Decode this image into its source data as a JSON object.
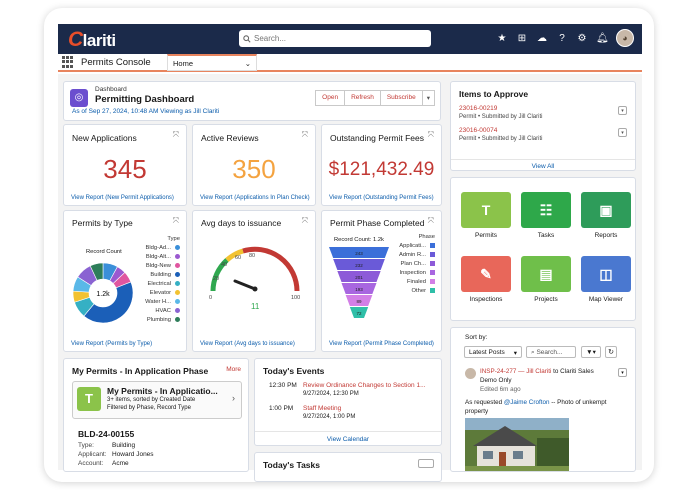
{
  "app": {
    "logo": "lariti",
    "logo_c": "C",
    "search_placeholder": "Search...",
    "app_name": "Permits Console",
    "tab": "Home"
  },
  "header": {
    "small": "Dashboard",
    "title": "Permitting Dashboard",
    "asof": "As of Sep 27, 2024, 10:48 AM Viewing as Jill Clariti",
    "buttons": [
      "Open",
      "Refresh",
      "Subscribe"
    ]
  },
  "kpis": [
    {
      "title": "New Applications",
      "value": "345",
      "color": "#c23934",
      "link": "View Report (New Permit Applications)"
    },
    {
      "title": "Active Reviews",
      "value": "350",
      "color": "#f4a340",
      "link": "View Report (Applications In Plan Check)"
    },
    {
      "title": "Outstanding Permit Fees",
      "value": "$121,432.49",
      "color": "#c23934",
      "link": "View Report (Outstanding Permit Fees)"
    }
  ],
  "permits_by_type": {
    "title": "Permits by Type",
    "legend_title": "Type",
    "record_count_label": "Record Count",
    "center": "1.2k",
    "link": "View Report (Permits by Type)",
    "items": [
      {
        "label": "Bldg-Ad...",
        "color": "#3b8fd9"
      },
      {
        "label": "Bldg-Alt...",
        "color": "#9b59d0"
      },
      {
        "label": "Bldg-New",
        "color": "#e056a0"
      },
      {
        "label": "Building",
        "color": "#1b5fb8"
      },
      {
        "label": "Electrical",
        "color": "#35b0c4"
      },
      {
        "label": "Elevator",
        "color": "#f2c231"
      },
      {
        "label": "Water H...",
        "color": "#5ab8e8"
      },
      {
        "label": "HVAC",
        "color": "#8a63d2"
      },
      {
        "label": "Plumbing",
        "color": "#2e7d5a"
      }
    ]
  },
  "avg_days": {
    "title": "Avg days to issuance",
    "value": "11",
    "min": "0",
    "max": "100",
    "ticks": [
      "20",
      "40",
      "60",
      "80"
    ],
    "link": "View Report (Avg days to issuance)"
  },
  "phase": {
    "title": "Permit Phase Completed",
    "record_count": "Record Count: 1.2k",
    "legend_title": "Phase",
    "link": "View Report (Permit Phase Completed)",
    "legend": [
      {
        "label": "Applicati...",
        "color": "#3b6fd9"
      },
      {
        "label": "Admin R...",
        "color": "#6a5ad8"
      },
      {
        "label": "Plan Ch...",
        "color": "#8d5ad8"
      },
      {
        "label": "Inspection",
        "color": "#a866e0"
      },
      {
        "label": "Finaled",
        "color": "#d27fe6"
      },
      {
        "label": "Other",
        "color": "#2fbfa8"
      }
    ],
    "bar_labels": [
      "243",
      "232",
      "201",
      "193",
      "89",
      "72"
    ]
  },
  "approve": {
    "title": "Items to Approve",
    "view_all": "View All",
    "items": [
      {
        "id": "23016-00219",
        "sub": "Permit  •  Submitted by Jill Clariti"
      },
      {
        "id": "23016-00074",
        "sub": "Permit  •  Submitted by Jill Clariti"
      }
    ]
  },
  "tiles": [
    {
      "label": "Permits",
      "color": "#8bc34a",
      "glyph": "T"
    },
    {
      "label": "Tasks",
      "color": "#2ea84a",
      "glyph": "☷"
    },
    {
      "label": "Reports",
      "color": "#2e9c5a",
      "glyph": "▣"
    },
    {
      "label": "Inspections",
      "color": "#e8675a",
      "glyph": "✎"
    },
    {
      "label": "Projects",
      "color": "#6fbf4a",
      "glyph": "▤"
    },
    {
      "label": "Map Viewer",
      "color": "#4a78d0",
      "glyph": "◫"
    }
  ],
  "my_permits": {
    "title": "My Permits - In Application Phase",
    "more": "More",
    "list_title": "My Permits - In Applicatio...",
    "sub1": "3+ items, sorted by Created Date",
    "sub2": "Filtered by Phase, Record Type",
    "record": "BLD-24-00155",
    "fields": [
      {
        "k": "Type:",
        "v": "Building"
      },
      {
        "k": "Applicant:",
        "v": "Howard Jones"
      },
      {
        "k": "Account:",
        "v": "Acme"
      }
    ]
  },
  "events": {
    "title": "Today's Events",
    "view_calendar": "View Calendar",
    "items": [
      {
        "time": "12:30 PM",
        "title": "Review Ordinance Changes to Section 1...",
        "date": "9/27/2024, 12:30 PM"
      },
      {
        "time": "1:00 PM",
        "title": "Staff Meeting",
        "date": "9/27/2024, 1:00 PM"
      }
    ]
  },
  "tasks": {
    "title": "Today's Tasks"
  },
  "feed": {
    "sort_by": "Sort by:",
    "sort_value": "Latest Posts",
    "search_placeholder": "Search...",
    "post_link": "INSP-24-277 — Jill Clariti",
    "post_to": " to Clariti Sales",
    "post_line2": "Demo Only",
    "edited": "Edited 6m ago",
    "mention_pre": "As requested ",
    "mention": "@Jaime Crofton",
    "mention_post": " -- Photo of unkempt property"
  },
  "colors": {
    "nav": "#1b2a4a",
    "accent": "#e8845e",
    "link": "#0b5cab",
    "red": "#c23934"
  }
}
